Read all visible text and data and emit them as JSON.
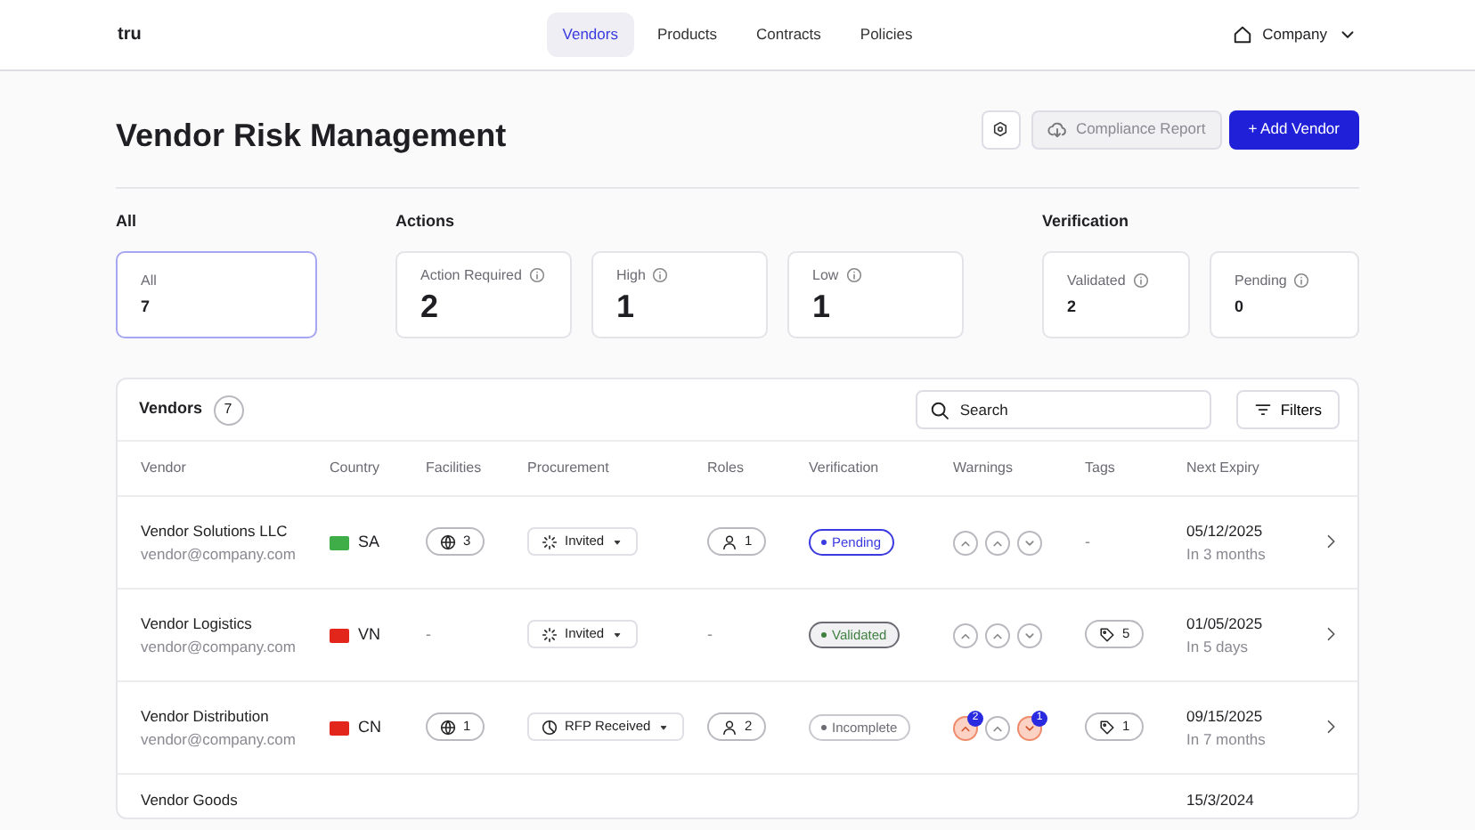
{
  "brand": "tru",
  "nav": [
    {
      "label": "Vendors",
      "selected": true
    },
    {
      "label": "Products",
      "selected": false
    },
    {
      "label": "Contracts",
      "selected": false
    },
    {
      "label": "Policies",
      "selected": false
    }
  ],
  "company": "Company",
  "title": "Vendor Risk Management",
  "actions": {
    "report": "Compliance Report",
    "add": "+ Add Vendor"
  },
  "stat_groups": [
    {
      "title": "All",
      "cards": [
        {
          "label": "All",
          "value": "7",
          "selected": true,
          "big": false,
          "info": false
        }
      ]
    },
    {
      "title": "Actions",
      "cards": [
        {
          "label": "Action Required",
          "value": "2",
          "selected": false,
          "big": true,
          "info": true
        },
        {
          "label": "High",
          "value": "1",
          "selected": false,
          "big": true,
          "info": true
        },
        {
          "label": "Low",
          "value": "1",
          "selected": false,
          "big": true,
          "info": true
        }
      ]
    },
    {
      "title": "Verification",
      "cards": [
        {
          "label": "Validated",
          "value": "2",
          "selected": false,
          "big": false,
          "info": true
        },
        {
          "label": "Pending",
          "value": "0",
          "selected": false,
          "big": false,
          "info": true
        }
      ]
    }
  ],
  "table": {
    "title": "Vendors",
    "count": "7",
    "search_placeholder": "Search",
    "filters": "Filters",
    "columns": [
      "Vendor",
      "Country",
      "Facilities",
      "Procurement",
      "Roles",
      "Verification",
      "Warnings",
      "Tags",
      "Next Expiry"
    ],
    "rows": [
      {
        "name": "Vendor Solutions LLC",
        "email": "vendor@company.com",
        "color": "#3fae49",
        "country": "SA",
        "facilities": "3",
        "procurement": {
          "kind": "invited",
          "label": "Invited"
        },
        "roles": "1",
        "verification": {
          "kind": "pending",
          "label": "Pending"
        },
        "warnings": [
          {
            "kind": "up",
            "alert": false
          },
          {
            "kind": "up",
            "alert": false
          },
          {
            "kind": "down",
            "alert": false
          }
        ],
        "tags": "-",
        "expiry": "05/12/2025",
        "expiry_note": "In 3 months"
      },
      {
        "name": "Vendor Logistics",
        "email": "vendor@company.com",
        "color": "#e3261c",
        "country": "VN",
        "facilities": "-",
        "procurement": {
          "kind": "invited",
          "label": "Invited"
        },
        "roles": "-",
        "verification": {
          "kind": "validated",
          "label": "Validated"
        },
        "warnings": [
          {
            "kind": "up",
            "alert": false
          },
          {
            "kind": "up",
            "alert": false
          },
          {
            "kind": "down",
            "alert": false
          }
        ],
        "tags": "5",
        "expiry": "01/05/2025",
        "expiry_note": "In 5 days"
      },
      {
        "name": "Vendor Distribution",
        "email": "vendor@company.com",
        "color": "#e3261c",
        "country": "CN",
        "facilities": "1",
        "procurement": {
          "kind": "rfp",
          "label": "RFP Received"
        },
        "roles": "2",
        "verification": {
          "kind": "incomplete",
          "label": "Incomplete"
        },
        "warnings": [
          {
            "kind": "up",
            "alert": true,
            "count": "2"
          },
          {
            "kind": "up",
            "alert": false
          },
          {
            "kind": "down",
            "alert": true,
            "count": "1"
          }
        ],
        "tags": "1",
        "expiry": "09/15/2025",
        "expiry_note": "In 7 months"
      },
      {
        "name": "Vendor Goods",
        "expiry": "15/3/2024"
      }
    ]
  }
}
